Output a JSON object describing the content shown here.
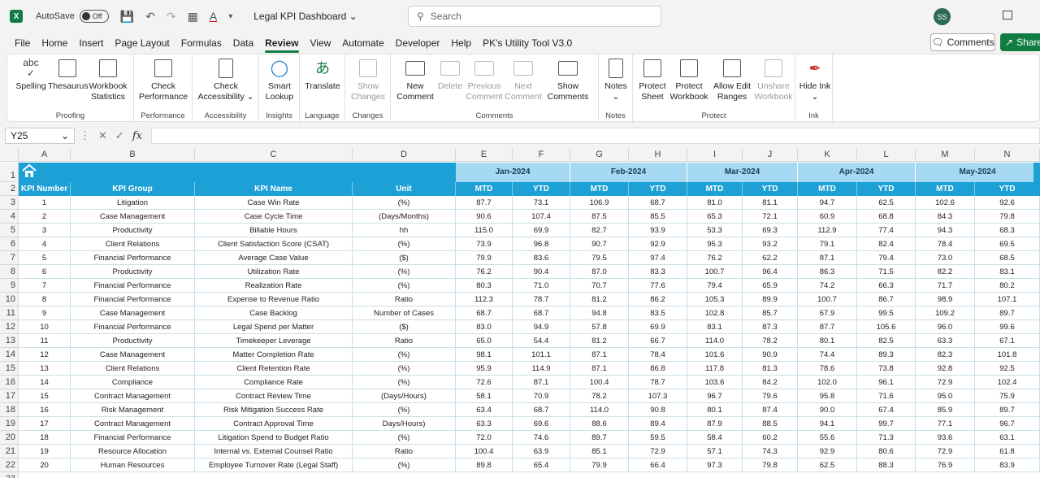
{
  "titlebar": {
    "autosave_label": "AutoSave",
    "toggle_state": "Off",
    "doc_title": "Legal KPI Dashboard",
    "search_placeholder": "Search",
    "avatar_initials": "SS"
  },
  "menu": {
    "tabs": [
      "File",
      "Home",
      "Insert",
      "Page Layout",
      "Formulas",
      "Data",
      "Review",
      "View",
      "Automate",
      "Developer",
      "Help",
      "PK's Utility Tool V3.0"
    ],
    "active_tab": "Review",
    "comments_button": "Comments",
    "share_button": "Share"
  },
  "ribbon": {
    "groups": [
      {
        "name": "Proofing",
        "buttons": [
          "Spelling",
          "Thesaurus",
          "Workbook Statistics"
        ]
      },
      {
        "name": "Performance",
        "buttons": [
          "Check Performance"
        ]
      },
      {
        "name": "Accessibility",
        "buttons": [
          "Check Accessibility"
        ]
      },
      {
        "name": "Insights",
        "buttons": [
          "Smart Lookup"
        ]
      },
      {
        "name": "Language",
        "buttons": [
          "Translate"
        ]
      },
      {
        "name": "Changes",
        "buttons": [
          "Show Changes"
        ]
      },
      {
        "name": "Comments",
        "buttons": [
          "New Comment",
          "Delete",
          "Previous Comment",
          "Next Comment",
          "Show Comments"
        ]
      },
      {
        "name": "Notes",
        "buttons": [
          "Notes"
        ]
      },
      {
        "name": "Protect",
        "buttons": [
          "Protect Sheet",
          "Protect Workbook",
          "Allow Edit Ranges",
          "Unshare Workbook"
        ]
      },
      {
        "name": "Ink",
        "buttons": [
          "Hide Ink"
        ]
      }
    ]
  },
  "formula_bar": {
    "name_box": "Y25",
    "fx": "fx"
  },
  "columns": [
    "A",
    "B",
    "C",
    "D",
    "E",
    "F",
    "G",
    "H",
    "I",
    "J",
    "K",
    "L",
    "M",
    "N"
  ],
  "months": [
    "Jan-2024",
    "Feb-2024",
    "Mar-2024",
    "Apr-2024",
    "May-2024"
  ],
  "headers": {
    "kpi_number": "KPI Number",
    "kpi_group": "KPI Group",
    "kpi_name": "KPI Name",
    "unit": "Unit",
    "mtd": "MTD",
    "ytd": "YTD"
  },
  "rows": [
    {
      "n": "1",
      "g": "Litigation",
      "name": "Case Win Rate",
      "u": "(%)",
      "v": [
        "87.7",
        "73.1",
        "106.9",
        "68.7",
        "81.0",
        "81.1",
        "94.7",
        "62.5",
        "102.6",
        "92.6"
      ]
    },
    {
      "n": "2",
      "g": "Case Management",
      "name": "Case Cycle Time",
      "u": "(Days/Months)",
      "v": [
        "90.6",
        "107.4",
        "87.5",
        "85.5",
        "65.3",
        "72.1",
        "60.9",
        "68.8",
        "84.3",
        "79.8"
      ]
    },
    {
      "n": "3",
      "g": "Productivity",
      "name": "Billable Hours",
      "u": "hh",
      "v": [
        "115.0",
        "69.9",
        "82.7",
        "93.9",
        "53.3",
        "69.3",
        "112.9",
        "77.4",
        "94.3",
        "68.3"
      ]
    },
    {
      "n": "4",
      "g": "Client Relations",
      "name": "Client Satisfaction Score (CSAT)",
      "u": "(%)",
      "v": [
        "73.9",
        "96.8",
        "90.7",
        "92.9",
        "95.3",
        "93.2",
        "79.1",
        "82.4",
        "78.4",
        "69.5"
      ]
    },
    {
      "n": "5",
      "g": "Financial Performance",
      "name": "Average Case Value",
      "u": "($)",
      "v": [
        "79.9",
        "83.6",
        "79.5",
        "97.4",
        "76.2",
        "62.2",
        "87.1",
        "79.4",
        "73.0",
        "68.5"
      ]
    },
    {
      "n": "6",
      "g": "Productivity",
      "name": "Utilization Rate",
      "u": "(%)",
      "v": [
        "76.2",
        "90.4",
        "87.0",
        "83.3",
        "100.7",
        "96.4",
        "86.3",
        "71.5",
        "82.2",
        "83.1"
      ]
    },
    {
      "n": "7",
      "g": "Financial Performance",
      "name": "Realization Rate",
      "u": "(%)",
      "v": [
        "80.3",
        "71.0",
        "70.7",
        "77.6",
        "79.4",
        "65.9",
        "74.2",
        "66.3",
        "71.7",
        "80.2"
      ]
    },
    {
      "n": "8",
      "g": "Financial Performance",
      "name": "Expense to Revenue Ratio",
      "u": "Ratio",
      "v": [
        "112.3",
        "78.7",
        "81.2",
        "86.2",
        "105.3",
        "89.9",
        "100.7",
        "86.7",
        "98.9",
        "107.1"
      ]
    },
    {
      "n": "9",
      "g": "Case Management",
      "name": "Case Backlog",
      "u": "Number of Cases",
      "v": [
        "68.7",
        "68.7",
        "94.8",
        "83.5",
        "102.8",
        "85.7",
        "67.9",
        "99.5",
        "109.2",
        "89.7"
      ]
    },
    {
      "n": "10",
      "g": "Financial Performance",
      "name": "Legal Spend per Matter",
      "u": "($)",
      "v": [
        "83.0",
        "94.9",
        "57.8",
        "69.9",
        "83.1",
        "87.3",
        "87.7",
        "105.6",
        "96.0",
        "99.6"
      ]
    },
    {
      "n": "11",
      "g": "Productivity",
      "name": "Timekeeper Leverage",
      "u": "Ratio",
      "v": [
        "65.0",
        "54.4",
        "81.2",
        "66.7",
        "114.0",
        "78.2",
        "80.1",
        "82.5",
        "63.3",
        "67.1"
      ]
    },
    {
      "n": "12",
      "g": "Case Management",
      "name": "Matter Completion Rate",
      "u": "(%)",
      "v": [
        "98.1",
        "101.1",
        "87.1",
        "78.4",
        "101.6",
        "90.9",
        "74.4",
        "89.3",
        "82.3",
        "101.8"
      ]
    },
    {
      "n": "13",
      "g": "Client Relations",
      "name": "Client Retention Rate",
      "u": "(%)",
      "v": [
        "95.9",
        "114.9",
        "87.1",
        "86.8",
        "117.8",
        "81.3",
        "78.6",
        "73.8",
        "92.8",
        "92.5"
      ]
    },
    {
      "n": "14",
      "g": "Compliance",
      "name": "Compliance Rate",
      "u": "(%)",
      "v": [
        "72.6",
        "87.1",
        "100.4",
        "78.7",
        "103.6",
        "84.2",
        "102.0",
        "96.1",
        "72.9",
        "102.4"
      ]
    },
    {
      "n": "15",
      "g": "Contract Management",
      "name": "Contract Review Time",
      "u": "(Days/Hours)",
      "v": [
        "58.1",
        "70.9",
        "78.2",
        "107.3",
        "96.7",
        "79.6",
        "95.8",
        "71.6",
        "95.0",
        "75.9"
      ]
    },
    {
      "n": "16",
      "g": "Risk Management",
      "name": "Risk Mitigation Success Rate",
      "u": "(%)",
      "v": [
        "63.4",
        "68.7",
        "114.0",
        "90.8",
        "80.1",
        "87.4",
        "90.0",
        "67.4",
        "85.9",
        "89.7"
      ]
    },
    {
      "n": "17",
      "g": "Contract Management",
      "name": "Contract Approval Time",
      "u": "Days/Hours)",
      "v": [
        "63.3",
        "69.6",
        "88.6",
        "89.4",
        "87.9",
        "88.5",
        "94.1",
        "99.7",
        "77.1",
        "96.7"
      ]
    },
    {
      "n": "18",
      "g": "Financial Performance",
      "name": "Litigation Spend to Budget Ratio",
      "u": "(%)",
      "v": [
        "72.0",
        "74.6",
        "89.7",
        "59.5",
        "58.4",
        "60.2",
        "55.6",
        "71.3",
        "93.6",
        "63.1"
      ]
    },
    {
      "n": "19",
      "g": "Resource Allocation",
      "name": "Internal vs. External Counsel Ratio",
      "u": "Ratio",
      "v": [
        "100.4",
        "63.9",
        "85.1",
        "72.9",
        "57.1",
        "74.3",
        "92.9",
        "80.6",
        "72.9",
        "61.8"
      ]
    },
    {
      "n": "20",
      "g": "Human Resources",
      "name": "Employee Turnover Rate (Legal Staff)",
      "u": "(%)",
      "v": [
        "89.8",
        "65.4",
        "79.9",
        "66.4",
        "97.3",
        "79.8",
        "62.5",
        "88.3",
        "76.9",
        "83.9"
      ]
    }
  ],
  "row_numbers": [
    "1",
    "2",
    "3",
    "4",
    "5",
    "6",
    "7",
    "8",
    "9",
    "10",
    "11",
    "12",
    "13",
    "14",
    "15",
    "16",
    "17",
    "18",
    "19",
    "20",
    "21",
    "22",
    "23"
  ],
  "colors": {
    "header_blue": "#1ca0d6",
    "month_light_blue": "#a6d9f2",
    "excel_green": "#107c41"
  }
}
